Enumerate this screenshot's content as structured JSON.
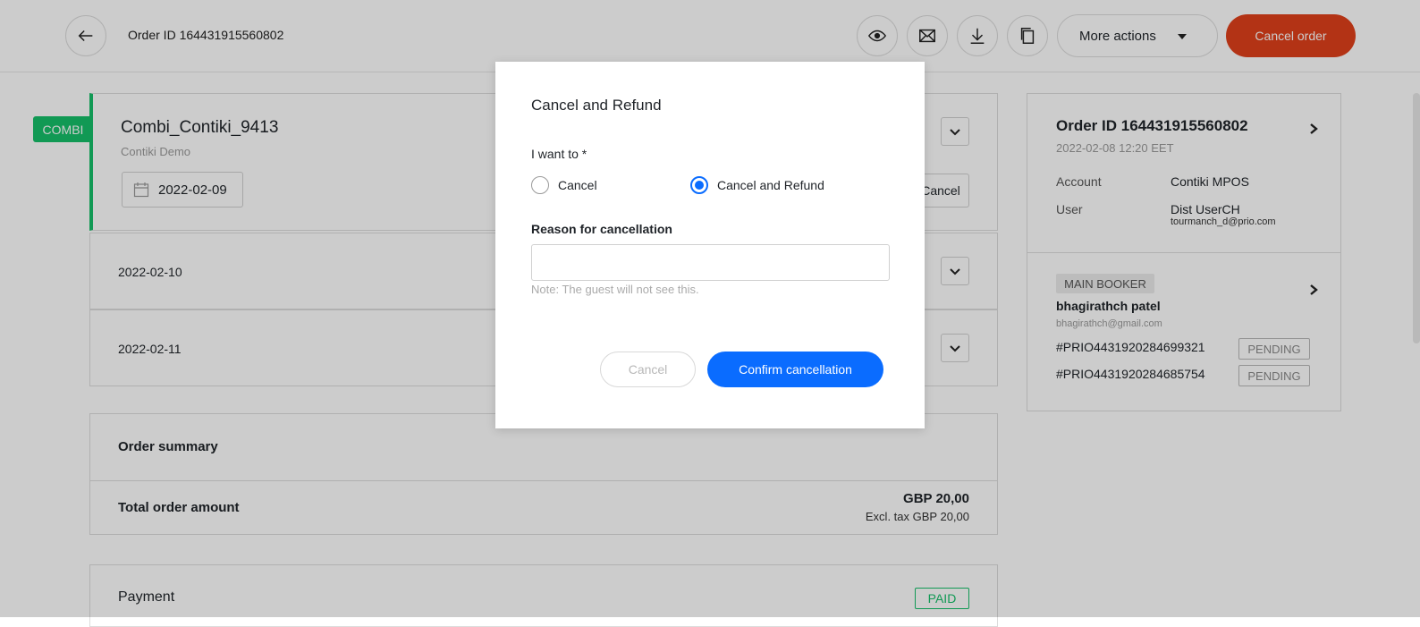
{
  "header": {
    "order_title": "Order ID 164431915560802",
    "more_actions_label": "More actions",
    "cancel_order_label": "Cancel order",
    "icons": [
      "back-arrow-icon",
      "eye-icon",
      "mail-icon",
      "download-icon",
      "copy-icon"
    ]
  },
  "combi": {
    "badge": "COMBI",
    "name": "Combi_Contiki_9413",
    "subtitle": "Contiki Demo",
    "date": "2022-02-09",
    "cancel_label": "Cancel"
  },
  "rows": [
    {
      "date": "2022-02-10"
    },
    {
      "date": "2022-02-11"
    }
  ],
  "summary": {
    "title": "Order summary",
    "total_label": "Total order amount",
    "total_amount": "GBP 20,00",
    "excl_tax": "Excl. tax GBP 20,00"
  },
  "payment": {
    "title": "Payment",
    "status": "PAID"
  },
  "right_panel": {
    "order_title": "Order ID 164431915560802",
    "order_date": "2022-02-08 12:20 EET",
    "account_label": "Account",
    "account_value": "Contiki MPOS",
    "user_label": "User",
    "user_value": "Dist UserCH",
    "user_email": "tourmanch_d@prio.com",
    "booker_badge": "MAIN BOOKER",
    "booker_name": "bhagirathch patel",
    "booker_email": "bhagirathch@gmail.com",
    "tickets": [
      {
        "id": "#PRIO4431920284699321",
        "status": "PENDING"
      },
      {
        "id": "#PRIO4431920284685754",
        "status": "PENDING"
      }
    ]
  },
  "modal": {
    "title": "Cancel and Refund",
    "want_label": "I want to *",
    "option_cancel": "Cancel",
    "option_cancel_refund": "Cancel and Refund",
    "selected_option": "Cancel and Refund",
    "reason_label": "Reason for cancellation",
    "reason_value": "",
    "note": "Note: The guest will not see this.",
    "cancel_button": "Cancel",
    "confirm_button": "Confirm cancellation"
  },
  "colors": {
    "accent_blue": "#0a6cff",
    "danger_red": "#e0401b",
    "combi_green": "#16c06a",
    "paid_green": "#16c06a"
  }
}
